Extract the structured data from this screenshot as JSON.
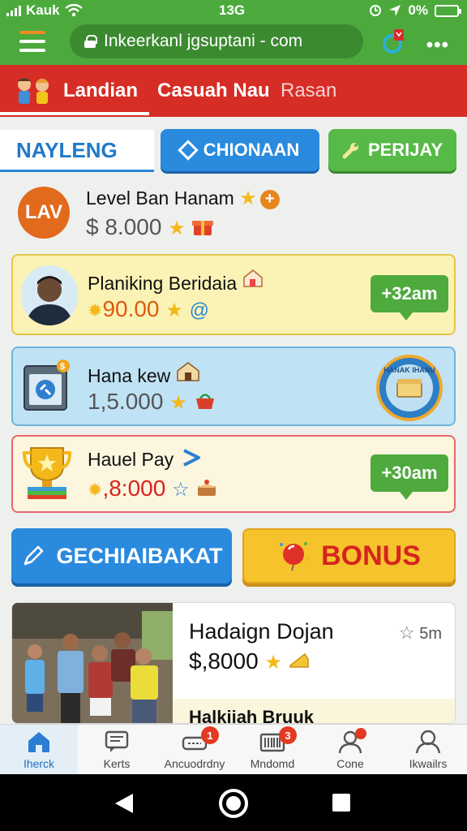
{
  "status_bar": {
    "carrier": "Kauk",
    "time": "13G",
    "battery": "0%"
  },
  "browser": {
    "url": "Inkeerkanl jgsuptani - com"
  },
  "top_nav": {
    "tabs": [
      "Landian",
      "Casuah Nau",
      "Rasan"
    ]
  },
  "tabs_row": {
    "active_tab": "NAYLENG",
    "button_blue": "CHIONAAN",
    "button_green": "PERIJAY"
  },
  "level": {
    "badge": "LAV",
    "title": "Level Ban Hanam",
    "value": "$ 8.000"
  },
  "cards": [
    {
      "title": "Planiking Beridaia",
      "value": "90.00",
      "time": "+32am"
    },
    {
      "title": "Hana kew",
      "value": "1,5.000",
      "seal_text": "HANAK IHANU"
    },
    {
      "title": "Hauel Pay",
      "value": ",8:000",
      "time": "+30am"
    }
  ],
  "actions": {
    "primary": "GECHIAIBAKAT",
    "bonus": "BONUS"
  },
  "feature": {
    "title": "Hadaign Dojan",
    "value": "$,8000",
    "time": "5m",
    "sub_title": "Halkiiah Bruuk"
  },
  "bottom_nav": {
    "items": [
      {
        "label": "Iherck",
        "badge": ""
      },
      {
        "label": "Kerts",
        "badge": ""
      },
      {
        "label": "Ancuodrdny",
        "badge": "1"
      },
      {
        "label": "Mndomd",
        "badge": "3"
      },
      {
        "label": "Cone",
        "badge": ""
      },
      {
        "label": "Ikwailrs",
        "badge": ""
      }
    ]
  },
  "colors": {
    "brand_green": "#4caa3c",
    "nav_red": "#d62d26",
    "accent_blue": "#2a8ade",
    "bonus_yellow": "#f7c32c"
  }
}
